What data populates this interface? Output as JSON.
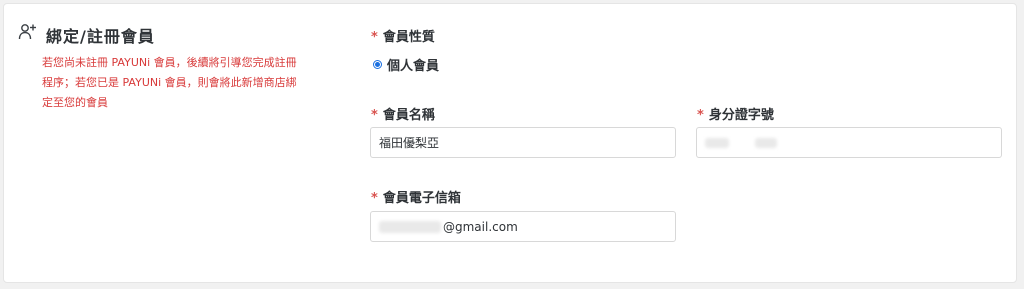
{
  "section": {
    "title": "綁定/註冊會員",
    "icon": "add-user-icon",
    "note_line1": "若您尚未註冊 PAYUNi 會員，後續將引導您完成註冊",
    "note_line2": "程序；若您已是 PAYUNi 會員，則會將此新增商店綁",
    "note_line3": "定至您的會員"
  },
  "form": {
    "required_mark": "*",
    "member_type": {
      "label": "會員性質",
      "selected_option": "個人會員"
    },
    "member_name": {
      "label": "會員名稱",
      "value": "福田優梨亞"
    },
    "id_number": {
      "label": "身分證字號",
      "value": ""
    },
    "email": {
      "label": "會員電子信箱",
      "value_visible": "@gmail.com"
    }
  },
  "colors": {
    "accent": "#1a6fe0",
    "note_text": "#d83a3a",
    "required": "#d9534f"
  }
}
